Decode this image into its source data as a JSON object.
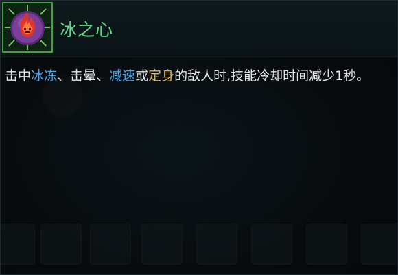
{
  "item": {
    "name": "冰之心",
    "icon": "flame-heart-icon"
  },
  "description": {
    "segments": [
      {
        "text": "击中",
        "style": "normal"
      },
      {
        "text": "冰冻",
        "style": "blue"
      },
      {
        "text": "、击晕、",
        "style": "normal"
      },
      {
        "text": "减速",
        "style": "blue"
      },
      {
        "text": "或",
        "style": "normal"
      },
      {
        "text": "定身",
        "style": "gold"
      },
      {
        "text": "的敌人时,技能冷却时间减少1秒。",
        "style": "normal"
      }
    ]
  },
  "colors": {
    "title": "#5ce08a",
    "keyword_blue": "#49a8e8",
    "keyword_gold": "#d9b35b",
    "frame_green": "#3fa63f",
    "text": "#e6e6e6"
  }
}
